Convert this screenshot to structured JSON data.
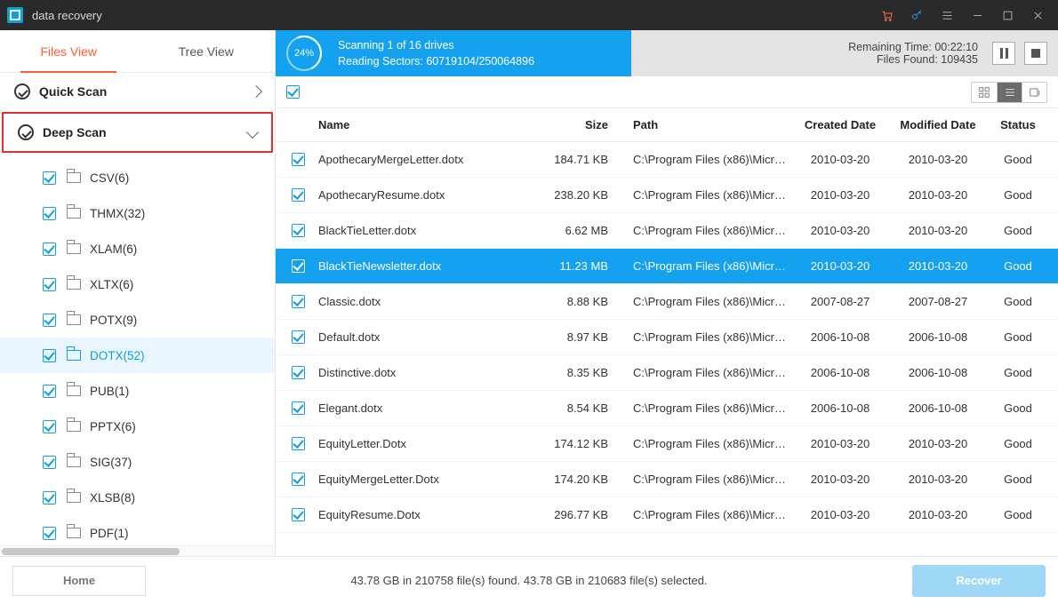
{
  "titlebar": {
    "title": "data recovery"
  },
  "tabs": {
    "files": "Files View",
    "tree": "Tree View"
  },
  "scan": {
    "quick": "Quick Scan",
    "deep": "Deep Scan"
  },
  "tree": [
    {
      "label": "CSV(6)"
    },
    {
      "label": "THMX(32)"
    },
    {
      "label": "XLAM(6)"
    },
    {
      "label": "XLTX(6)"
    },
    {
      "label": "POTX(9)"
    },
    {
      "label": "DOTX(52)",
      "selected": true
    },
    {
      "label": "PUB(1)"
    },
    {
      "label": "PPTX(6)"
    },
    {
      "label": "SIG(37)"
    },
    {
      "label": "XLSB(8)"
    },
    {
      "label": "PDF(1)"
    }
  ],
  "progress": {
    "percent": "24%",
    "line1": "Scanning 1 of  16 drives",
    "line2": "Reading Sectors: 60719104/250064896",
    "remaining": "Remaining Time: 00:22:10",
    "found": "Files Found: 109435"
  },
  "columns": {
    "name": "Name",
    "size": "Size",
    "path": "Path",
    "created": "Created Date",
    "modified": "Modified Date",
    "status": "Status"
  },
  "rows": [
    {
      "name": "ApothecaryMergeLetter.dotx",
      "size": "184.71 KB",
      "path": "C:\\Program Files (x86)\\Microsoft ...",
      "created": "2010-03-20",
      "modified": "2010-03-20",
      "status": "Good"
    },
    {
      "name": "ApothecaryResume.dotx",
      "size": "238.20 KB",
      "path": "C:\\Program Files (x86)\\Microsoft ...",
      "created": "2010-03-20",
      "modified": "2010-03-20",
      "status": "Good"
    },
    {
      "name": "BlackTieLetter.dotx",
      "size": "6.62 MB",
      "path": "C:\\Program Files (x86)\\Microsoft ...",
      "created": "2010-03-20",
      "modified": "2010-03-20",
      "status": "Good"
    },
    {
      "name": "BlackTieNewsletter.dotx",
      "size": "11.23 MB",
      "path": "C:\\Program Files (x86)\\Microsoft ...",
      "created": "2010-03-20",
      "modified": "2010-03-20",
      "status": "Good",
      "selected": true
    },
    {
      "name": "Classic.dotx",
      "size": "8.88 KB",
      "path": "C:\\Program Files (x86)\\Microsoft ...",
      "created": "2007-08-27",
      "modified": "2007-08-27",
      "status": "Good"
    },
    {
      "name": "Default.dotx",
      "size": "8.97 KB",
      "path": "C:\\Program Files (x86)\\Microsoft ...",
      "created": "2006-10-08",
      "modified": "2006-10-08",
      "status": "Good"
    },
    {
      "name": "Distinctive.dotx",
      "size": "8.35 KB",
      "path": "C:\\Program Files (x86)\\Microsoft ...",
      "created": "2006-10-08",
      "modified": "2006-10-08",
      "status": "Good"
    },
    {
      "name": "Elegant.dotx",
      "size": "8.54 KB",
      "path": "C:\\Program Files (x86)\\Microsoft ...",
      "created": "2006-10-08",
      "modified": "2006-10-08",
      "status": "Good"
    },
    {
      "name": "EquityLetter.Dotx",
      "size": "174.12 KB",
      "path": "C:\\Program Files (x86)\\Microsoft ...",
      "created": "2010-03-20",
      "modified": "2010-03-20",
      "status": "Good"
    },
    {
      "name": "EquityMergeLetter.Dotx",
      "size": "174.20 KB",
      "path": "C:\\Program Files (x86)\\Microsoft ...",
      "created": "2010-03-20",
      "modified": "2010-03-20",
      "status": "Good"
    },
    {
      "name": "EquityResume.Dotx",
      "size": "296.77 KB",
      "path": "C:\\Program Files (x86)\\Microsoft ...",
      "created": "2010-03-20",
      "modified": "2010-03-20",
      "status": "Good"
    }
  ],
  "footer": {
    "home": "Home",
    "status": "43.78 GB in 210758 file(s) found.   43.78 GB in 210683 file(s) selected.",
    "recover": "Recover"
  }
}
